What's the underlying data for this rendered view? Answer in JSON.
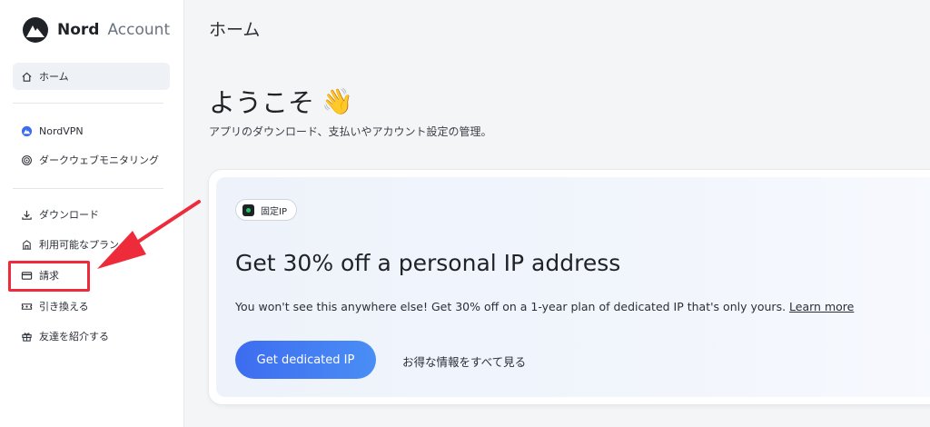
{
  "brand": {
    "name": "Nord",
    "product": "Account"
  },
  "sidebar": {
    "items": [
      {
        "label": "ホーム",
        "icon": "home-icon",
        "active": true
      },
      {
        "label": "NordVPN",
        "icon": "nordvpn-icon"
      },
      {
        "label": "ダークウェブモニタリング",
        "icon": "dark-web-monitor-icon"
      },
      {
        "label": "ダウンロード",
        "icon": "download-icon"
      },
      {
        "label": "利用可能なプラン",
        "icon": "plans-icon"
      },
      {
        "label": "請求",
        "icon": "credit-card-icon",
        "highlighted": true
      },
      {
        "label": "引き換える",
        "icon": "ticket-icon"
      },
      {
        "label": "友達を紹介する",
        "icon": "gift-icon"
      }
    ]
  },
  "annotation": {
    "highlight_color": "#ee2b3b"
  },
  "main": {
    "page_title": "ホーム",
    "welcome": "ようこそ",
    "welcome_emoji": "👋",
    "subtitle": "アプリのダウンロード、支払いやアカウント設定の管理。"
  },
  "promo": {
    "badge": "固定IP",
    "title": "Get 30% off a personal IP address",
    "text": "You won't see this anywhere else! Get 30% off on a 1-year plan of dedicated IP that's only yours.",
    "learn_more": "Learn more",
    "cta": "Get dedicated IP",
    "secondary": "お得な情報をすべて見る"
  },
  "colors": {
    "accent": "#3d6cf0",
    "accent_end": "#4a8ef5",
    "active_bg": "#eef1f6"
  }
}
